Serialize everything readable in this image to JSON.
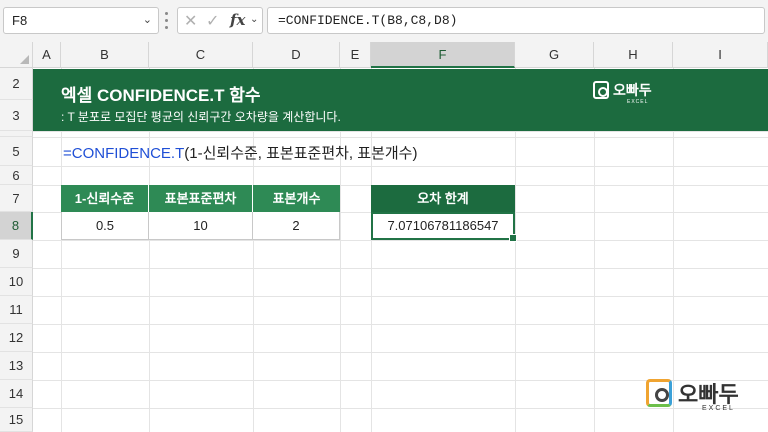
{
  "formula_bar": {
    "name_box": "F8",
    "formula": "=CONFIDENCE.T(B8,C8,D8)",
    "fx_label": "fx"
  },
  "columns": [
    "A",
    "B",
    "C",
    "D",
    "E",
    "F",
    "G",
    "H",
    "I"
  ],
  "selected_column": "F",
  "rows": [
    "2",
    "3",
    "",
    "5",
    "6",
    "7",
    "8",
    "9",
    "10",
    "11",
    "12",
    "13",
    "14",
    "15"
  ],
  "selected_row": "8",
  "banner": {
    "title": "엑셀 CONFIDENCE.T 함수",
    "subtitle": ": T 분포로 모집단 평균의 신뢰구간 오차량을 계산합니다.",
    "logo_text": "오빠두",
    "logo_sub": "EXCEL"
  },
  "syntax": {
    "func": "=CONFIDENCE.T",
    "args": "(1-신뢰수준, 표본표준편차, 표본개수)"
  },
  "table": {
    "headers": [
      "1-신뢰수준",
      "표본표준편차",
      "표본개수"
    ],
    "values": [
      "0.5",
      "10",
      "2"
    ]
  },
  "result": {
    "header": "오차 한계",
    "value": "7.07106781186547"
  },
  "footer_logo": {
    "text": "오빠두",
    "sub": "EXCEL"
  },
  "colors": {
    "banner": "#1c6b3f",
    "table_header": "#2e8a55",
    "function_blue": "#1f4fd6",
    "selection": "#217346"
  }
}
